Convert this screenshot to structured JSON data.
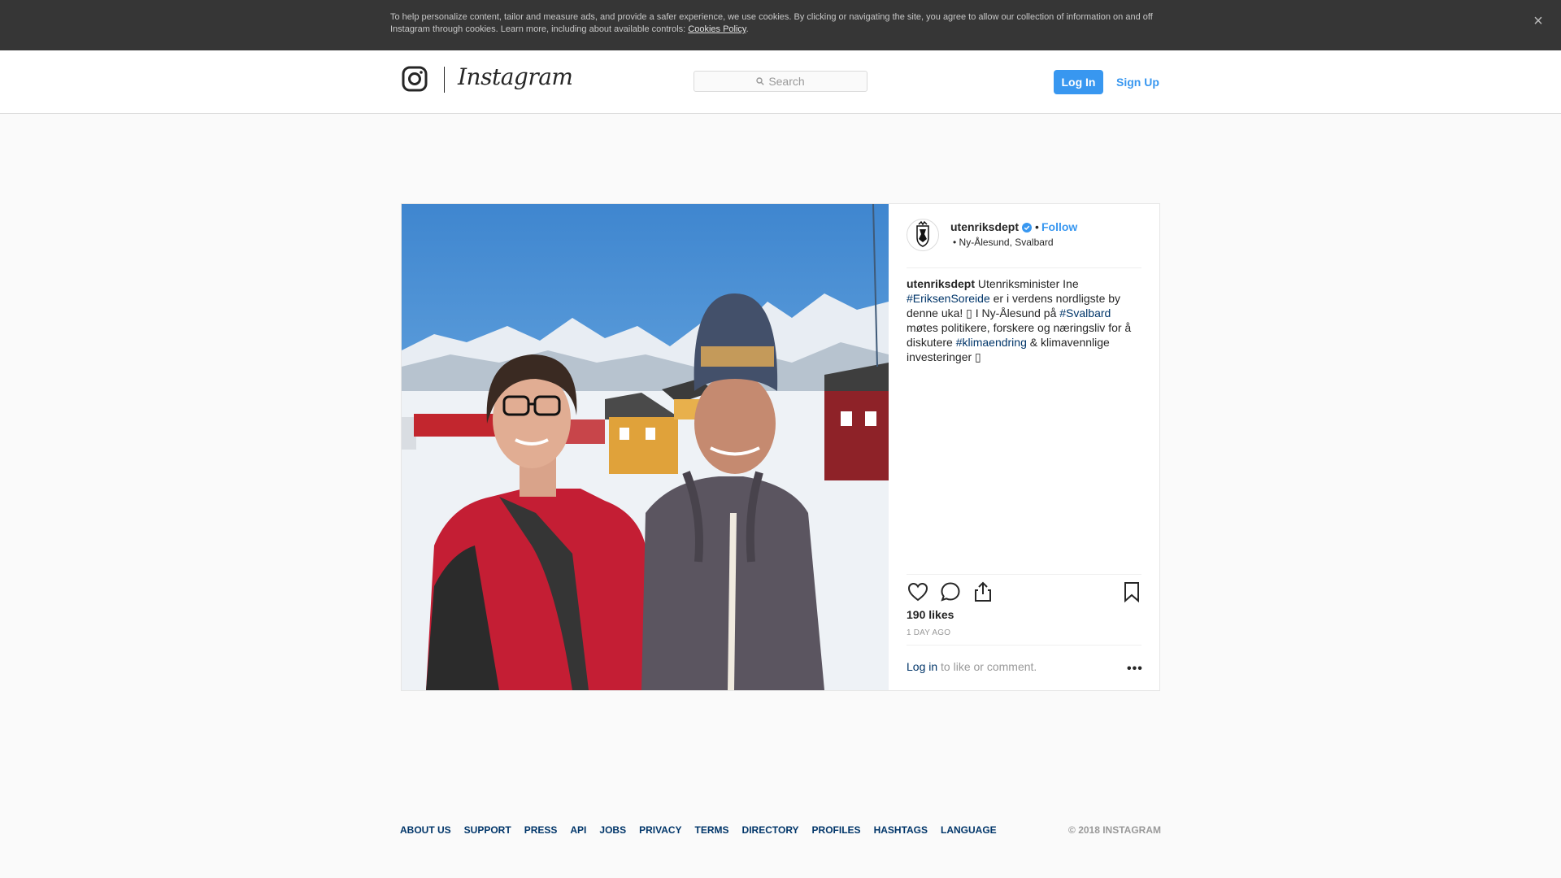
{
  "cookie_banner": {
    "text": "To help personalize content, tailor and measure ads, and provide a safer experience, we use cookies. By clicking or navigating the site, you agree to allow our collection of information on and off Instagram through cookies. Learn more, including about available controls: ",
    "link": "Cookies Policy",
    "end": ".",
    "close_glyph": "×"
  },
  "nav": {
    "logo_icon": "instagram-camera-icon",
    "wordmark": "Instagram",
    "search_placeholder": "Search",
    "login_label": "Log In",
    "signup_label": "Sign Up"
  },
  "post": {
    "username": "utenriksdept",
    "follow_label": "Follow",
    "separator": "•",
    "location": "Ny-Ålesund, Svalbard",
    "caption": {
      "user": "utenriksdept",
      "p1": " Utenriksminister Ine ",
      "tag1": "#EriksenSoreide",
      "p2": " er i verdens nordligste by denne uka! ▯  I Ny-Ålesund på ",
      "tag2": "#Svalbard",
      "p3": " møtes politikere, forskere og næringsliv for å diskutere ",
      "tag3": "#klimaendring",
      "p4": " & klimavennlige investeringer ▯"
    },
    "likes": "190 likes",
    "time_ago": "1 DAY AGO",
    "login_prompt_link": "Log in",
    "login_prompt_rest": " to like or comment.",
    "more_glyph": "•••",
    "icons": [
      "heart-icon",
      "comment-icon",
      "share-icon",
      "bookmark-icon",
      "verified-badge-icon"
    ]
  },
  "footer": {
    "links": [
      "ABOUT US",
      "SUPPORT",
      "PRESS",
      "API",
      "JOBS",
      "PRIVACY",
      "TERMS",
      "DIRECTORY",
      "PROFILES",
      "HASHTAGS",
      "LANGUAGE"
    ],
    "copyright": "© 2018 INSTAGRAM"
  },
  "colors": {
    "brand_blue": "#3897f0",
    "link_dark_blue": "#003569",
    "banner_bg": "#363636"
  }
}
